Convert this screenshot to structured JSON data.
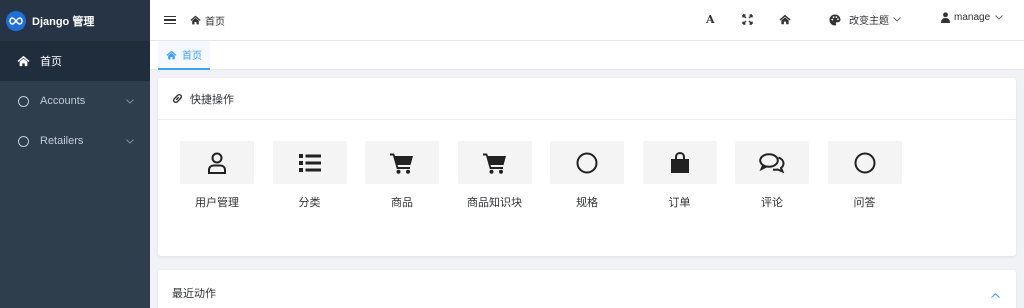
{
  "brand": {
    "name": "Django 管理",
    "logo_icon": "infinity-icon"
  },
  "sidebar": {
    "items": [
      {
        "label": "首页",
        "icon": "home-icon",
        "active": true
      },
      {
        "label": "Accounts",
        "icon": "circle-icon",
        "expandable": true
      },
      {
        "label": "Retailers",
        "icon": "circle-icon",
        "expandable": true
      }
    ]
  },
  "topbar": {
    "breadcrumb": "首页",
    "font_label": "A",
    "theme_label": "改变主题",
    "user_label": "manage"
  },
  "tabs": [
    {
      "label": "首页",
      "active": true
    }
  ],
  "quick": {
    "title": "快捷操作",
    "items": [
      {
        "label": "用户管理",
        "icon": "user-icon"
      },
      {
        "label": "分类",
        "icon": "list-icon"
      },
      {
        "label": "商品",
        "icon": "cart-icon"
      },
      {
        "label": "商品知识块",
        "icon": "cart-icon"
      },
      {
        "label": "规格",
        "icon": "circle-icon"
      },
      {
        "label": "订单",
        "icon": "shopping-bag-icon"
      },
      {
        "label": "评论",
        "icon": "comments-icon"
      },
      {
        "label": "问答",
        "icon": "circle-icon"
      }
    ]
  },
  "recent": {
    "title": "最近动作"
  },
  "colors": {
    "accent": "#409eff",
    "sidebar_bg": "#2f3e4d",
    "logo_bg": "#1e6fd8"
  }
}
